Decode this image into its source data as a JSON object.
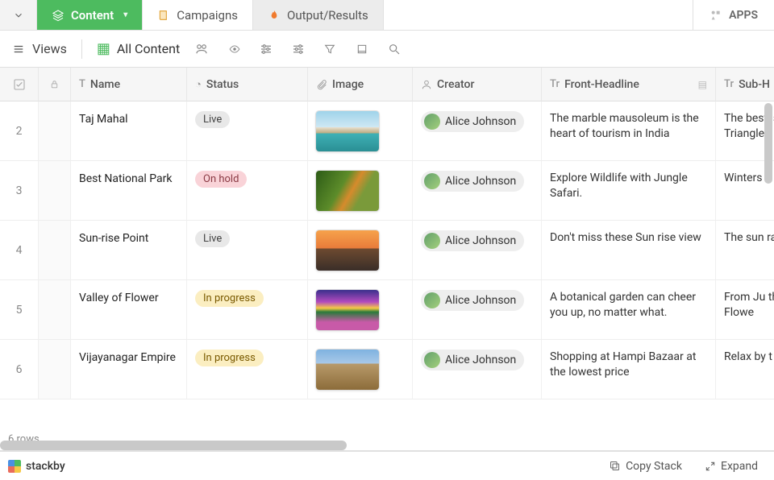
{
  "tabs": {
    "content": "Content",
    "campaigns": "Campaigns",
    "output": "Output/Results",
    "apps": "APPS"
  },
  "toolbar": {
    "views": "Views",
    "all_content": "All Content"
  },
  "columns": {
    "name": "Name",
    "status": "Status",
    "image": "Image",
    "creator": "Creator",
    "front_headline": "Front-Headline",
    "sub_h": "Sub-H"
  },
  "rows": [
    {
      "num": "2",
      "name": "Taj Mahal",
      "status": "Live",
      "status_class": "live",
      "creator": "Alice Johnson",
      "front": "The marble mausoleum is the heart of tourism in India",
      "sub": "The best is by taki Triangle",
      "thumb_css": "linear-gradient(to bottom,#9fd3ea 0%,#cfe8f3 40%,#e9e0cf 40%,#b9a97e 55%,#3fb1b6 55%,#2a8f94 100%)"
    },
    {
      "num": "3",
      "name": "Best National Park",
      "status": "On hold",
      "status_class": "hold",
      "creator": "Alice Johnson",
      "front": "Explore Wildlife with Jungle Safari.",
      "sub": "Winters a to visit",
      "thumb_css": "linear-gradient(120deg,#2c5b16,#5d8c2a 40%,#d68b2c 55%,#7a9a3a 70%)"
    },
    {
      "num": "4",
      "name": "Sun-rise Point",
      "status": "Live",
      "status_class": "live",
      "creator": "Alice Johnson",
      "front": "Don't miss these Sun rise view",
      "sub": "The sun rays are",
      "thumb_css": "linear-gradient(to bottom,#f6a24b 0%,#e87b3a 45%,#6e4a30 45%,#3a2e28 100%)"
    },
    {
      "num": "5",
      "name": "Valley of Flower",
      "status": "In progress",
      "status_class": "progress",
      "creator": "Alice Johnson",
      "front": "A botanical garden can cheer you up, no matter what.",
      "sub": "From Ju the best of Flowe",
      "thumb_css": "linear-gradient(to bottom,#3a2f8c 0%,#b34bbf 30%,#f6c945 45%,#2a7a3a 55%,#c85aa8 80%)"
    },
    {
      "num": "6",
      "name": "Vijayanagar Empire",
      "status": "In progress",
      "status_class": "progress",
      "creator": "Alice Johnson",
      "front": "Shopping at Hampi Bazaar at the lowest price",
      "sub": "Relax by t Sanapur",
      "thumb_css": "linear-gradient(to bottom,#7fb2e0 0%,#a9c9e8 35%,#b89a6a 35%,#8c6c3a 100%)"
    }
  ],
  "footer": {
    "rows_count": "6 rows",
    "brand": "stackby",
    "copy": "Copy Stack",
    "expand": "Expand"
  }
}
